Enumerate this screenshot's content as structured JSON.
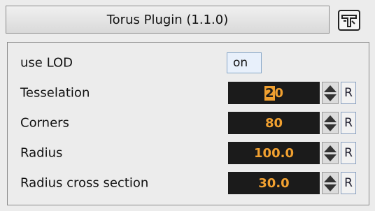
{
  "plugin": {
    "title": "Torus Plugin (1.1.0)",
    "icon": "plugin-logo-icon"
  },
  "params": [
    {
      "label": "use LOD",
      "type": "toggle",
      "value": "on"
    },
    {
      "label": "Tesselation",
      "type": "number",
      "value": "20",
      "value_selected": "2",
      "value_rest": "0",
      "reset": "R"
    },
    {
      "label": "Corners",
      "type": "number",
      "value": "80",
      "reset": "R"
    },
    {
      "label": "Radius",
      "type": "number",
      "value": "100.0",
      "reset": "R"
    },
    {
      "label": "Radius cross section",
      "type": "number",
      "value": "30.0",
      "reset": "R"
    }
  ],
  "colors": {
    "field_bg": "#1b1b1b",
    "field_text": "#f0a030",
    "panel_bg": "#ececec"
  }
}
